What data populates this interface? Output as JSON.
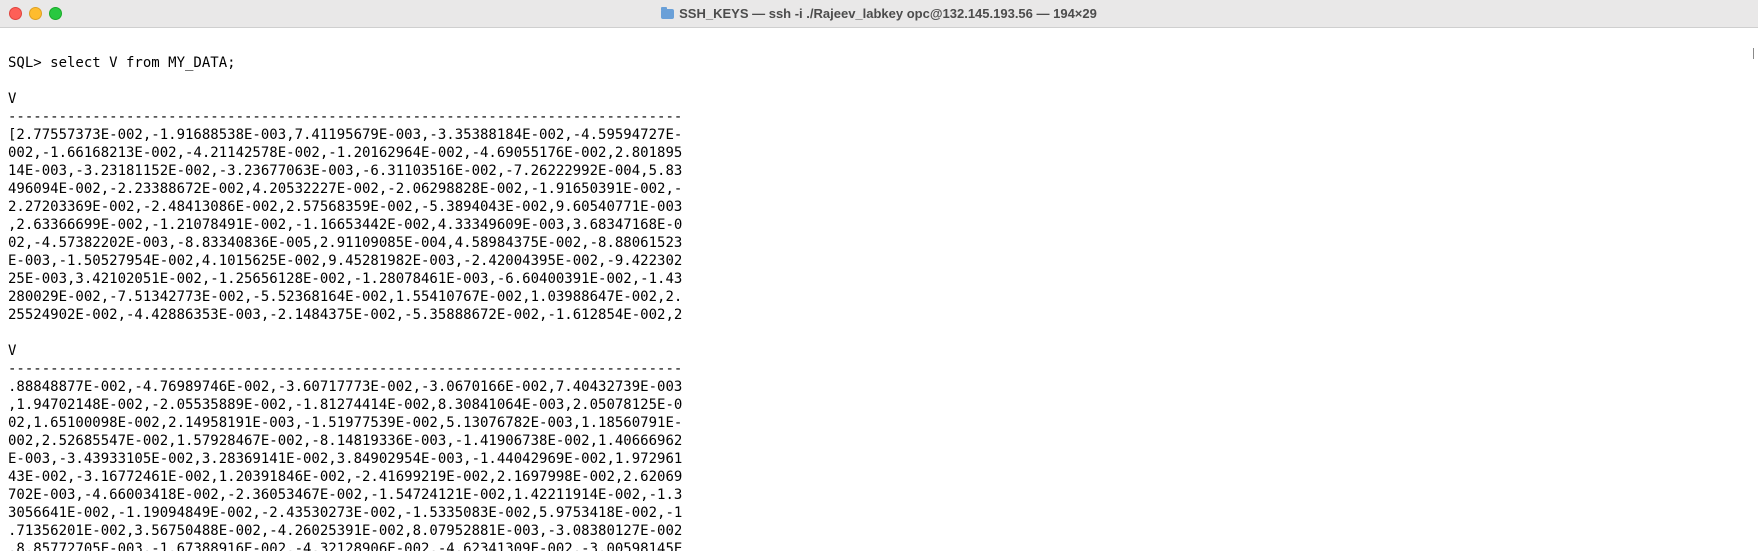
{
  "window": {
    "title": "SSH_KEYS — ssh -i ./Rajeev_labkey opc@132.145.193.56 — 194×29",
    "buttons": {
      "close_glyph": "×"
    }
  },
  "terminal": {
    "lines": [
      "",
      "SQL> select V from MY_DATA;",
      "",
      "V",
      "--------------------------------------------------------------------------------",
      "[2.77557373E-002,-1.91688538E-003,7.41195679E-003,-3.35388184E-002,-4.59594727E-",
      "002,-1.66168213E-002,-4.21142578E-002,-1.20162964E-002,-4.69055176E-002,2.801895",
      "14E-003,-3.23181152E-002,-3.23677063E-003,-6.31103516E-002,-7.26222992E-004,5.83",
      "496094E-002,-2.23388672E-002,4.20532227E-002,-2.06298828E-002,-1.91650391E-002,-",
      "2.27203369E-002,-2.48413086E-002,2.57568359E-002,-5.3894043E-002,9.60540771E-003",
      ",2.63366699E-002,-1.21078491E-002,-1.16653442E-002,4.33349609E-003,3.68347168E-0",
      "02,-4.57382202E-003,-8.83340836E-005,2.91109085E-004,4.58984375E-002,-8.88061523",
      "E-003,-1.50527954E-002,4.1015625E-002,9.45281982E-003,-2.42004395E-002,-9.422302",
      "25E-003,3.42102051E-002,-1.25656128E-002,-1.28078461E-003,-6.60400391E-002,-1.43",
      "280029E-002,-7.51342773E-002,-5.52368164E-002,1.55410767E-002,1.03988647E-002,2.",
      "25524902E-002,-4.42886353E-003,-2.1484375E-002,-5.35888672E-002,-1.612854E-002,2",
      "",
      "V",
      "--------------------------------------------------------------------------------",
      ".88848877E-002,-4.76989746E-002,-3.60717773E-002,-3.0670166E-002,7.40432739E-003",
      ",1.94702148E-002,-2.05535889E-002,-1.81274414E-002,8.30841064E-003,2.05078125E-0",
      "02,1.65100098E-002,2.14958191E-003,-1.51977539E-002,5.13076782E-003,1.18560791E-",
      "002,2.52685547E-002,1.57928467E-002,-8.14819336E-003,-1.41906738E-002,1.40666962",
      "E-003,-3.43933105E-002,3.28369141E-002,3.84902954E-003,-1.44042969E-002,1.972961",
      "43E-002,-3.16772461E-002,1.20391846E-002,-2.41699219E-002,2.1697998E-002,2.62069",
      "702E-003,-4.66003418E-002,-2.36053467E-002,-1.54724121E-002,1.42211914E-002,-1.3",
      "3056641E-002,-1.19094849E-002,-2.43530273E-002,-1.5335083E-002,5.9753418E-002,-1",
      ".71356201E-002,3.56750488E-002,-4.26025391E-002,8.07952881E-003,-3.08380127E-002",
      ",8.85772705E-003,-1.67388916E-002,-4.32128906E-002,-4.62341309E-002,-3.00598145E"
    ]
  }
}
